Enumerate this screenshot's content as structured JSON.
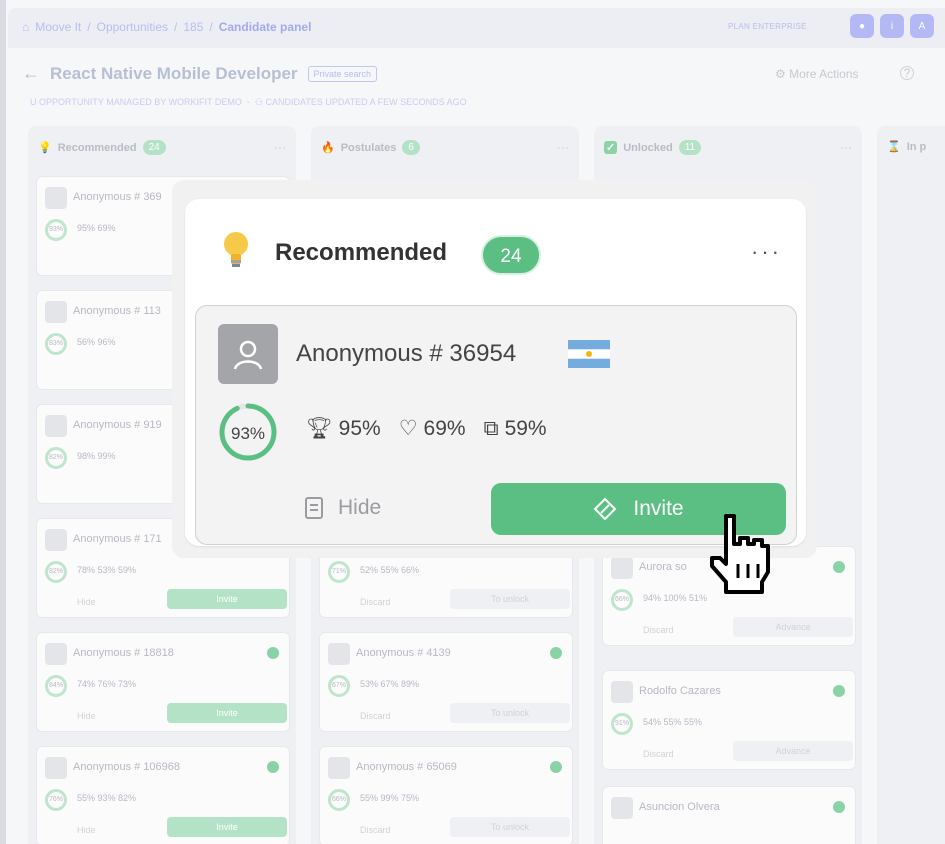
{
  "breadcrumb": {
    "home": "Moove It",
    "section": "Opportunities",
    "id": "185",
    "current": "Candidate panel"
  },
  "plan": "PLAN ENTERPRISE",
  "page": {
    "title": "React Native Mobile Developer",
    "badge": "Private search",
    "managed": "OPPORTUNITY MANAGED BY WORKIFIT DEMO",
    "updated": "CANDIDATES UPDATED A FEW SECONDS AGO",
    "more_actions": "More Actions"
  },
  "columns": [
    {
      "title": "Recommended",
      "count": "24"
    },
    {
      "title": "Postulates",
      "count": "6"
    },
    {
      "title": "Unlocked",
      "count": "11"
    },
    {
      "title": "In p",
      "count": ""
    }
  ],
  "bg_cards": {
    "c1": [
      {
        "name": "Anonymous # 369",
        "score": "93%",
        "stats": "95%  69%"
      },
      {
        "name": "Anonymous # 113",
        "score": "83%",
        "stats": "56%  96%"
      },
      {
        "name": "Anonymous # 919",
        "score": "82%",
        "stats": "98%  99%"
      },
      {
        "name": "Anonymous # 171",
        "score": "82%",
        "stats": "78%  53%  59%"
      },
      {
        "name": "Anonymous # 18818",
        "score": "84%",
        "stats": "74%  76%  73%"
      },
      {
        "name": "Anonymous # 106968",
        "score": "76%",
        "stats": "55%  93%  82%"
      }
    ],
    "c2": [
      {
        "name": "",
        "score": "71%",
        "stats": "52%  55%  66%"
      },
      {
        "name": "Anonymous # 4139",
        "score": "67%",
        "stats": "53%  67%  89%"
      },
      {
        "name": "Anonymous # 65069",
        "score": "66%",
        "stats": "55%  99%  75%"
      }
    ],
    "c3": [
      {
        "name": "Aurora so",
        "score": "66%",
        "stats": "94%  100%  51%"
      },
      {
        "name": "Rodolfo Cazares",
        "score": "91%",
        "stats": "54%  55%  55%"
      },
      {
        "name": "Asuncion Olvera",
        "score": "",
        "stats": ""
      }
    ],
    "labels": {
      "hide": "Hide",
      "invite": "Invite",
      "discard": "Discard",
      "unlock": "To unlock",
      "advance": "Advance"
    }
  },
  "zoom": {
    "title": "Recommended",
    "count": "24",
    "card": {
      "name": "Anonymous # 36954",
      "score": "93%",
      "score_value": 93,
      "trophy": "95%",
      "heart": "69%",
      "puzzle": "59%",
      "hide": "Hide",
      "invite": "Invite"
    }
  },
  "colors": {
    "green": "#5bbf83",
    "purple": "#b4b9f6"
  }
}
